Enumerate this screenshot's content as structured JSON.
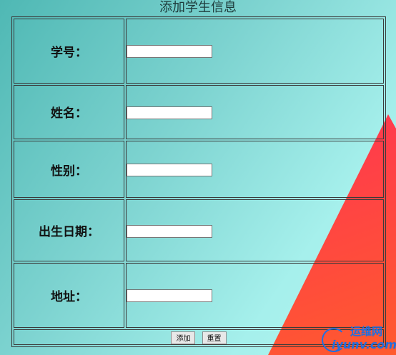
{
  "page": {
    "title": "添加学生信息"
  },
  "form": {
    "rows": [
      {
        "label": "学号：",
        "value": ""
      },
      {
        "label": "姓名：",
        "value": ""
      },
      {
        "label": "性别：",
        "value": ""
      },
      {
        "label": "出生日期：",
        "value": ""
      },
      {
        "label": "地址：",
        "value": ""
      }
    ],
    "submit_label": "添加",
    "reset_label": "重置"
  },
  "watermark": {
    "top_text": "运维网",
    "bottom_text": "iyunv.com"
  },
  "colors": {
    "background": "#7dd3d0",
    "accent": "#ff2a5a",
    "watermark": "#1f6fe0"
  }
}
